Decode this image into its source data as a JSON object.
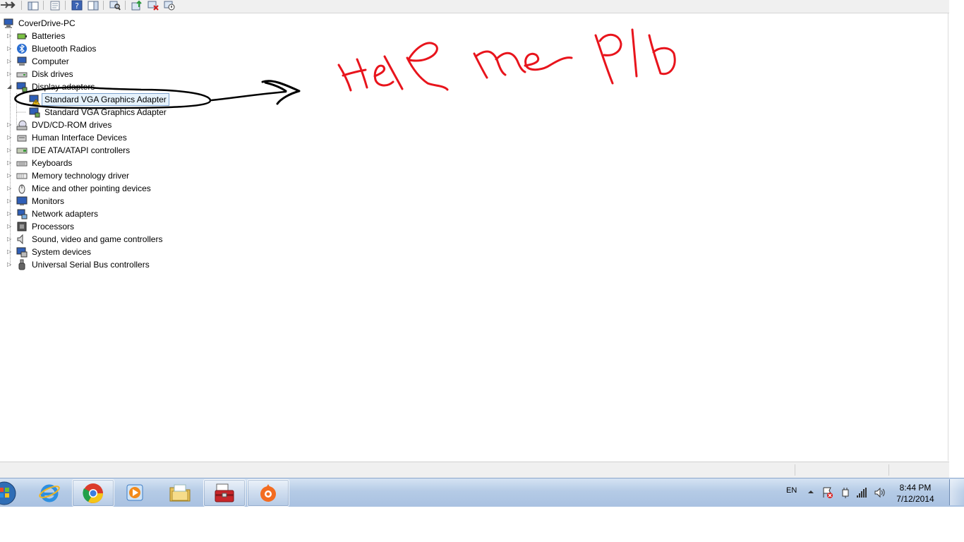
{
  "tree": {
    "root_label": "CoverDrive-PC",
    "categories": [
      {
        "label": "Batteries",
        "icon": "battery-icon"
      },
      {
        "label": "Bluetooth Radios",
        "icon": "bluetooth-icon"
      },
      {
        "label": "Computer",
        "icon": "computer-icon"
      },
      {
        "label": "Disk drives",
        "icon": "disk-drive-icon"
      },
      {
        "label": "Display adapters",
        "icon": "display-adapter-icon",
        "expanded": true
      },
      {
        "label": "DVD/CD-ROM drives",
        "icon": "dvd-drive-icon"
      },
      {
        "label": "Human Interface Devices",
        "icon": "hid-icon"
      },
      {
        "label": "IDE ATA/ATAPI controllers",
        "icon": "ide-controller-icon"
      },
      {
        "label": "Keyboards",
        "icon": "keyboard-icon"
      },
      {
        "label": "Memory technology driver",
        "icon": "memory-icon"
      },
      {
        "label": "Mice and other pointing devices",
        "icon": "mouse-icon"
      },
      {
        "label": "Monitors",
        "icon": "monitor-icon"
      },
      {
        "label": "Network adapters",
        "icon": "network-adapter-icon"
      },
      {
        "label": "Processors",
        "icon": "processor-icon"
      },
      {
        "label": "Sound, video and game controllers",
        "icon": "sound-icon"
      },
      {
        "label": "System devices",
        "icon": "system-devices-icon"
      },
      {
        "label": "Universal Serial Bus controllers",
        "icon": "usb-icon"
      }
    ],
    "display_children": [
      {
        "label": "Standard VGA Graphics Adapter",
        "selected": true,
        "warning": true
      },
      {
        "label": "Standard VGA Graphics Adapter",
        "selected": false,
        "warning": false
      }
    ]
  },
  "annotation": {
    "handwritten_text": "Help me pls",
    "text_color": "#e8141c",
    "marker_color": "#000000"
  },
  "taskbar": {
    "pinned_apps": [
      "start-orb-icon",
      "internet-explorer-icon",
      "chrome-icon",
      "media-player-icon",
      "file-explorer-icon",
      "device-manager-toolbox-icon",
      "origin-icon"
    ]
  },
  "tray": {
    "language": "EN",
    "time": "8:44 PM",
    "date": "7/12/2014"
  },
  "colors": {
    "selection_bg": "#e6f2fc",
    "selection_border": "#7da2ce",
    "taskbar": "#b5cbe6"
  }
}
